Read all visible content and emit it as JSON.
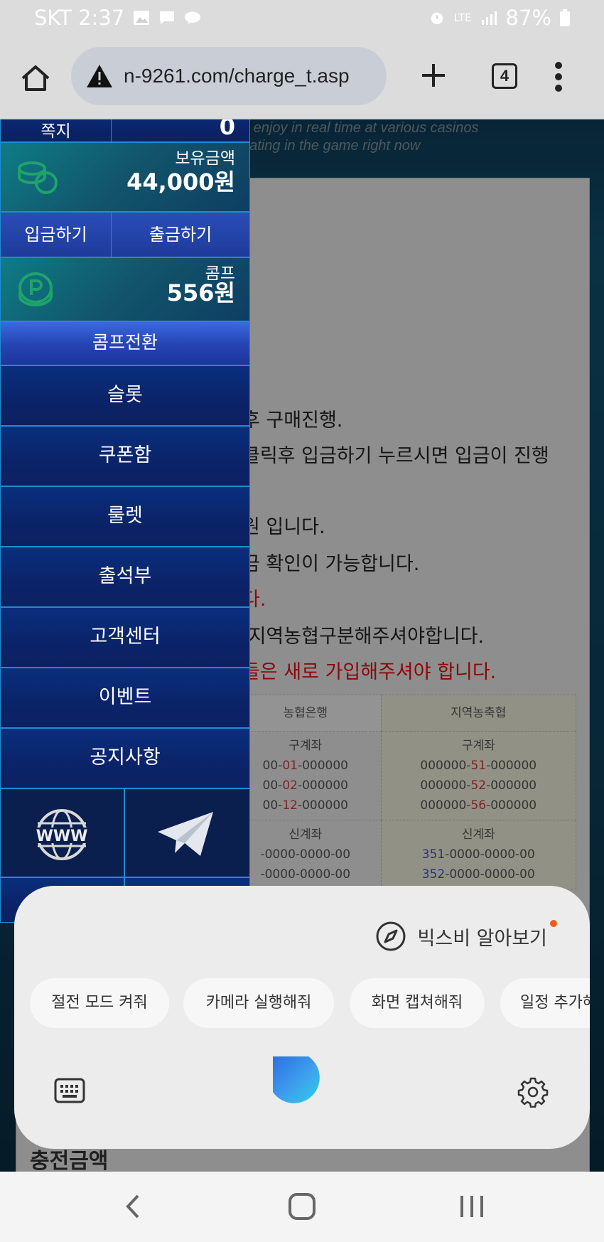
{
  "status_bar": {
    "carrier_time": "SKT 2:37",
    "battery": "87%",
    "network": "LTE"
  },
  "browser": {
    "url": "n-9261.com/charge_t.asp",
    "tab_count": "4"
  },
  "page": {
    "banner_lines": [
      "n enjoy in real time at various casinos",
      "pating in the game right now"
    ],
    "info_lines": [
      {
        "text": "후 구매진행.",
        "color": "black"
      },
      {
        "text": "클릭후 입금하기 누르시면 입금이 진행",
        "color": "black"
      },
      {
        "text": "원 입니다.",
        "color": "black"
      },
      {
        "text": "금 확인이 가능합니다.",
        "color": "black"
      },
      {
        "text": "다.",
        "color": "red"
      },
      {
        "text": ".지역농협구분해주셔야합니다.",
        "color": "black"
      },
      {
        "text": "들은 새로 가입해주셔야 합니다.",
        "color": "red"
      }
    ],
    "bank_table": {
      "headers": [
        "농협은행",
        "지역농축협"
      ],
      "old_label": "구계좌",
      "new_label": "신계좌",
      "col1_old": [
        [
          "00-",
          "01",
          "-000000"
        ],
        [
          "00-",
          "02",
          "-000000"
        ],
        [
          "00-",
          "12",
          "-000000"
        ]
      ],
      "col2_old": [
        [
          "000000-",
          "51",
          "-000000"
        ],
        [
          "000000-",
          "52",
          "-000000"
        ],
        [
          "000000-",
          "56",
          "-000000"
        ]
      ],
      "col1_new": [
        "-0000-0000-00",
        "-0000-0000-00"
      ],
      "col2_new": [
        [
          "351",
          "-0000-0000-00"
        ],
        [
          "352",
          "-0000-0000-00"
        ]
      ]
    },
    "charge_label": "충전금액"
  },
  "side_menu": {
    "memo_label": "쪽지",
    "memo_count": "0",
    "balance_label": "보유금액",
    "balance_value": "44,000원",
    "deposit_button": "입금하기",
    "withdraw_button": "출금하기",
    "comp_label": "콤프",
    "comp_value": "556원",
    "comp_convert_button": "콤프전환",
    "items": [
      "슬롯",
      "쿠폰함",
      "룰렛",
      "출석부",
      "고객센터",
      "이벤트",
      "공지사항"
    ],
    "icon_www_label": "WWW"
  },
  "bixby": {
    "learn_label": "빅스비 알아보기",
    "suggestions": [
      "절전 모드 켜줘",
      "카메라 실행해줘",
      "화면 캡쳐해줘",
      "일정 추가해줘"
    ]
  },
  "colors": {
    "red_text": "#e01010",
    "menu_border": "#1d8dd0",
    "notification_dot": "#f05a19"
  }
}
